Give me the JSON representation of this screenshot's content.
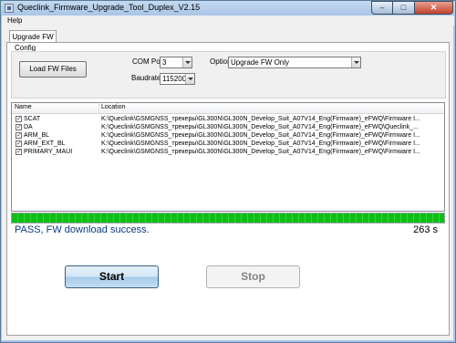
{
  "window": {
    "title": "Queclink_Firmware_Upgrade_Tool_Duplex_V2.15"
  },
  "menu": {
    "help": "Help"
  },
  "tabs": [
    {
      "label": "Upgrade FW"
    }
  ],
  "config": {
    "group_label": "Config",
    "load_button": "Load FW Files",
    "com_port_label": "COM Port:",
    "com_port_value": "3",
    "option_label": "Option:",
    "option_value": "Upgrade FW Only",
    "baudrate_label": "Baudrate:",
    "baudrate_value": "115200"
  },
  "files": {
    "columns": [
      "Name",
      "Location"
    ],
    "rows": [
      {
        "checked": true,
        "name": "SCAT",
        "location": "K:\\Queclink\\GSMGNSS_трекеры\\GL300N\\GL300N_Develop_Suit_A07V14_Eng(Firmware)_eFWQ\\Firmware I..."
      },
      {
        "checked": true,
        "name": "DA",
        "location": "K:\\Queclink\\GSMGNSS_трекеры\\GL300N\\GL300N_Develop_Suit_A07V14_Eng(Firmware)_eFWQ\\Queclink_..."
      },
      {
        "checked": true,
        "name": "ARM_BL",
        "location": "K:\\Queclink\\GSMGNSS_трекеры\\GL300N\\GL300N_Develop_Suit_A07V14_Eng(Firmware)_eFWQ\\Firmware I..."
      },
      {
        "checked": true,
        "name": "ARM_EXT_BL",
        "location": "K:\\Queclink\\GSMGNSS_трекеры\\GL300N\\GL300N_Develop_Suit_A07V14_Eng(Firmware)_eFWQ\\Firmware I..."
      },
      {
        "checked": true,
        "name": "PRIMARY_MAUI",
        "location": "K:\\Queclink\\GSMGNSS_трекеры\\GL300N\\GL300N_Develop_Suit_A07V14_Eng(Firmware)_eFWQ\\Firmware I..."
      }
    ]
  },
  "progress": {
    "percent": 100,
    "color": "#0fbe16"
  },
  "status": {
    "message": "PASS, FW download success.",
    "elapsed": "263 s",
    "color": "#0a3a80"
  },
  "actions": {
    "start": "Start",
    "stop": "Stop"
  }
}
